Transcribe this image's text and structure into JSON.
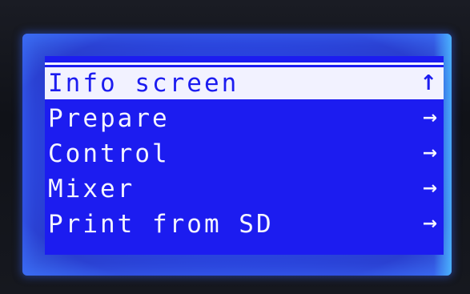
{
  "lcd_menu": {
    "items": [
      {
        "label": "Info screen",
        "arrow": "↑",
        "selected": true
      },
      {
        "label": "Prepare",
        "arrow": "→",
        "selected": false
      },
      {
        "label": "Control",
        "arrow": "→",
        "selected": false
      },
      {
        "label": "Mixer",
        "arrow": "→",
        "selected": false
      },
      {
        "label": "Print from SD",
        "arrow": "→",
        "selected": false
      }
    ]
  },
  "colors": {
    "lcd_background": "#1c1cf0",
    "lcd_text": "#f4f4ff",
    "highlight_background": "#f2f2ff"
  },
  "icons": {
    "back": "up-arrow-icon",
    "submenu": "right-arrow-icon"
  }
}
